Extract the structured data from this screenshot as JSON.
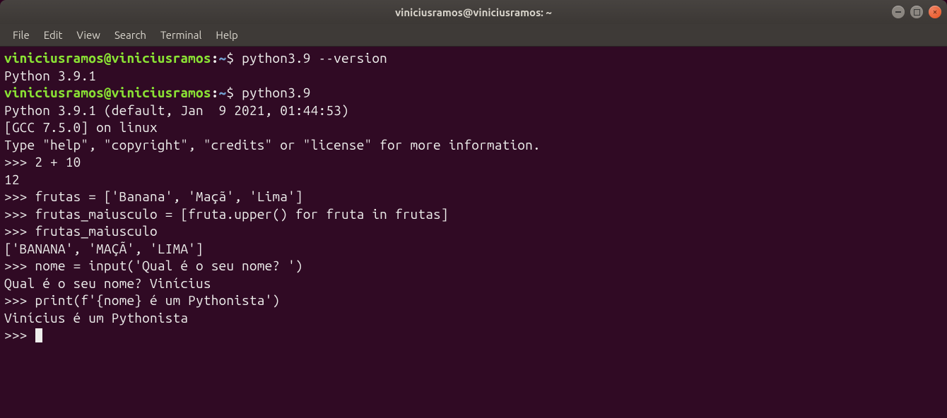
{
  "window": {
    "title": "viniciusramos@viniciusramos: ~"
  },
  "menubar": {
    "items": [
      "File",
      "Edit",
      "View",
      "Search",
      "Terminal",
      "Help"
    ]
  },
  "prompt": {
    "user": "viniciusramos",
    "at": "@",
    "host": "viniciusramos",
    "colon": ":",
    "path": "~",
    "dollar": "$ "
  },
  "repl_prompt": ">>> ",
  "lines": {
    "l1_cmd": "python3.9 --version",
    "l2_out": "Python 3.9.1",
    "l3_cmd": "python3.9",
    "l4_out": "Python 3.9.1 (default, Jan  9 2021, 01:44:53) ",
    "l5_out": "[GCC 7.5.0] on linux",
    "l6_out": "Type \"help\", \"copyright\", \"credits\" or \"license\" for more information.",
    "l7_in": "2 + 10",
    "l8_out": "12",
    "l9_in": "frutas = ['Banana', 'Maçã', 'Lima']",
    "l10_in": "frutas_maiusculo = [fruta.upper() for fruta in frutas]",
    "l11_in": "frutas_maiusculo",
    "l12_out": "['BANANA', 'MAÇÃ', 'LIMA']",
    "l13_in": "nome = input('Qual é o seu nome? ')",
    "l14_out": "Qual é o seu nome? Vinícius",
    "l15_in": "print(f'{nome} é um Pythonista')",
    "l16_out": "Vinícius é um Pythonista"
  }
}
